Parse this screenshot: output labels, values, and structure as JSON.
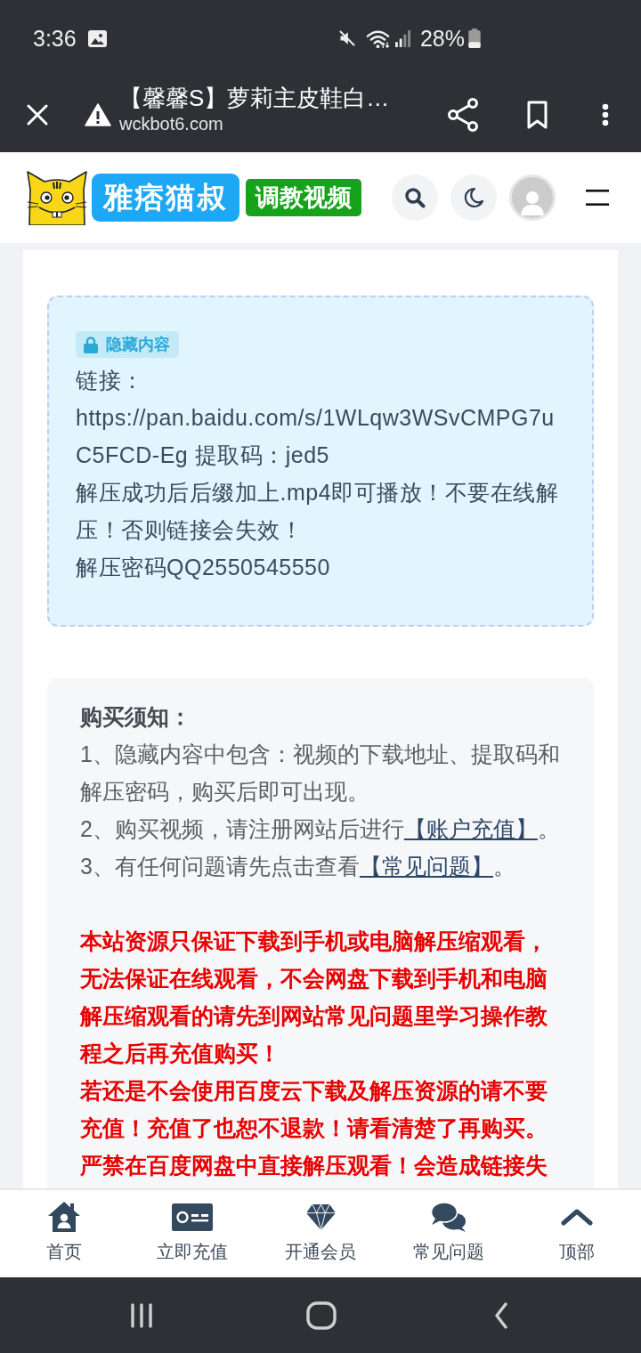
{
  "status_bar": {
    "time": "3:36",
    "battery": "28%"
  },
  "browser_bar": {
    "title": "【馨馨S】萝莉主皮鞋白…",
    "url": "wckbot6.com"
  },
  "site_header": {
    "logo_text": "雅痞猫叔",
    "category": "调教视频"
  },
  "hidden_content": {
    "tag": "隐藏内容",
    "lines": [
      "链接：",
      "https://pan.baidu.com/s/1WLqw3WSvCMPG7uC5FCD-Eg 提取码：jed5",
      "解压成功后后缀加上.mp4即可播放！不要在线解压！否则链接会失效！",
      "解压密码QQ2550545550"
    ]
  },
  "purchase_notice": {
    "title": "购买须知：",
    "items": [
      {
        "text": "1、隐藏内容中包含：视频的下载地址、提取码和解压密码，购买后即可出现。"
      },
      {
        "text": "2、购买视频，请注册网站后进行",
        "link": "【账户充值】",
        "after": "。"
      },
      {
        "text": "3、有任何问题请先点击查看",
        "link": "【常见问题】",
        "after": "。"
      }
    ],
    "warnings": [
      "本站资源只保证下载到手机或电脑解压缩观看，无法保证在线观看，不会网盘下载到手机和电脑解压缩观看的请先到网站常见问题里学习操作教程之后再充值购买！",
      "若还是不会使用百度云下载及解压资源的请不要充值！充值了也恕不退款！请看清楚了再购买。",
      "严禁在百度网盘中直接解压观看！会造成链接失"
    ]
  },
  "bottom_nav": [
    {
      "kind": "home",
      "label": "首页"
    },
    {
      "kind": "recharge",
      "label": "立即充值"
    },
    {
      "kind": "vip",
      "label": "开通会员"
    },
    {
      "kind": "faq",
      "label": "常见问题"
    },
    {
      "kind": "top",
      "label": "顶部"
    }
  ]
}
